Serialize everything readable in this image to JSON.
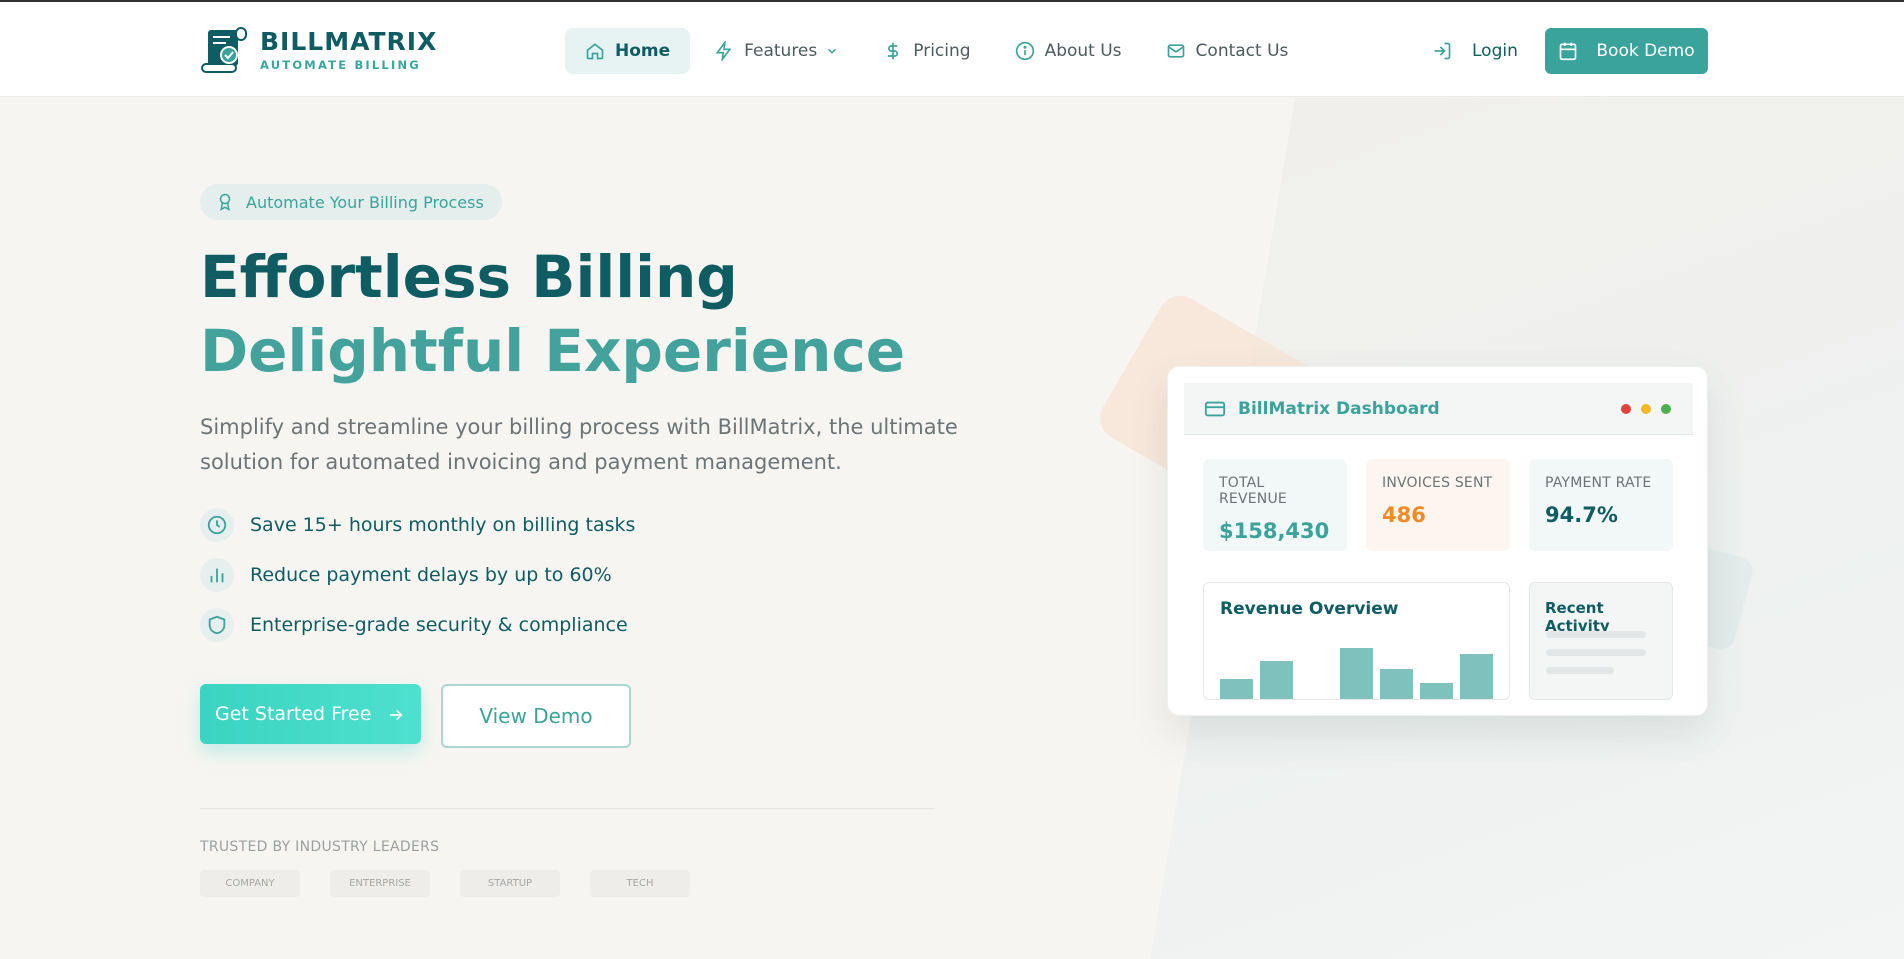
{
  "brand": {
    "title": "BILLMATRIX",
    "subtitle": "AUTOMATE BILLING"
  },
  "nav": {
    "items": [
      {
        "label": "Home",
        "icon": "home-icon",
        "active": true
      },
      {
        "label": "Features",
        "icon": "bolt-icon",
        "dropdown": true
      },
      {
        "label": "Pricing",
        "icon": "dollar-icon"
      },
      {
        "label": "About Us",
        "icon": "info-icon"
      },
      {
        "label": "Contact Us",
        "icon": "mail-icon"
      }
    ],
    "login_label": "Login",
    "book_demo_label": "Book Demo"
  },
  "hero": {
    "badge": "Automate Your Billing Process",
    "headline_line1": "Effortless Billing",
    "headline_line2": "Delightful Experience",
    "lead": "Simplify and streamline your billing process with BillMatrix, the ultimate solution for automated invoicing and payment management.",
    "benefits": [
      {
        "text": "Save 15+ hours monthly on billing tasks",
        "icon": "clock-icon"
      },
      {
        "text": "Reduce payment delays by up to 60%",
        "icon": "bar-chart-icon"
      },
      {
        "text": "Enterprise-grade security & compliance",
        "icon": "shield-icon"
      }
    ],
    "primary_cta": "Get Started Free",
    "secondary_cta": "View Demo",
    "trusted_label": "TRUSTED BY INDUSTRY LEADERS",
    "trusted_logos": [
      "COMPANY",
      "ENTERPRISE",
      "STARTUP",
      "TECH"
    ]
  },
  "dashboard": {
    "title": "BillMatrix Dashboard",
    "stats": [
      {
        "label": "TOTAL REVENUE",
        "value": "$158,430",
        "color": "#3aa39b",
        "bg": "#f2f7f7"
      },
      {
        "label": "INVOICES SENT",
        "value": "486",
        "color": "#f08a24",
        "bg": "#fdf6f0"
      },
      {
        "label": "PAYMENT RATE",
        "value": "94.7%",
        "color": "#0f5c63",
        "bg": "#f2f7f7"
      }
    ],
    "revenue_title": "Revenue Overview",
    "revenue_bars": [
      0.33,
      0.62,
      0,
      0.82,
      0.48,
      0.25,
      0.72
    ],
    "activity_title": "Recent Activity",
    "window_dots": [
      "#e0443a",
      "#f2b824",
      "#4caf50"
    ]
  },
  "colors": {
    "primary": "#0f5c63",
    "accent": "#3aa39b",
    "cta": "#3ad4c1"
  }
}
